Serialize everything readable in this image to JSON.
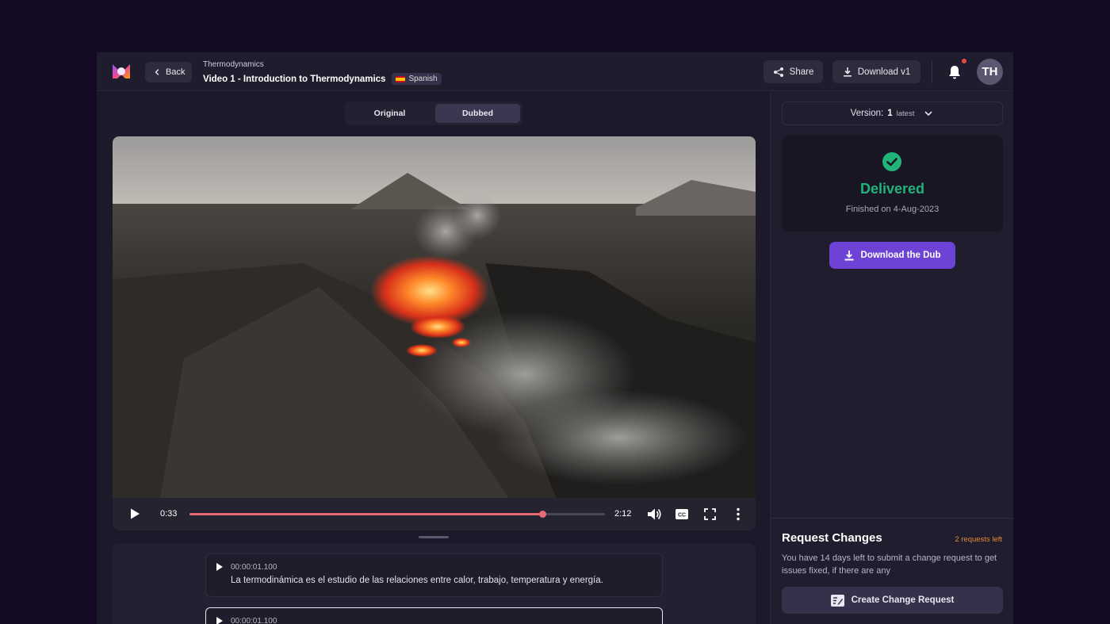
{
  "header": {
    "back_label": "Back",
    "course": "Thermodynamics",
    "video_title": "Video 1 - Introduction to Thermodynamics",
    "language": "Spanish",
    "share_label": "Share",
    "download_label": "Download v1",
    "avatar_initials": "TH"
  },
  "view_toggle": {
    "options": [
      "Original",
      "Dubbed"
    ],
    "selected": "Dubbed"
  },
  "player": {
    "current_time": "0:33",
    "duration": "2:12",
    "progress_fraction": 0.85
  },
  "transcript": {
    "segments": [
      {
        "time": "00:00:01.100",
        "text": "La termodinámica es el estudio de las relaciones entre calor, trabajo, temperatura y energía."
      },
      {
        "time": "00:00:01.100",
        "text": ""
      }
    ]
  },
  "version": {
    "label": "Version:",
    "number": "1",
    "tag": "latest"
  },
  "status": {
    "state": "Delivered",
    "finished": "Finished on 4-Aug-2023",
    "color": "#22b37a"
  },
  "download_dub_label": "Download the Dub",
  "request_changes": {
    "title": "Request Changes",
    "remaining": "2 requests left",
    "description": "You have 14 days left to submit a change request to get issues fixed, if there are any",
    "button_label": "Create Change Request"
  },
  "colors": {
    "background": "#140a24",
    "accent": "#6d43d6",
    "progress": "#e86a75",
    "warning": "#e08a3c"
  }
}
